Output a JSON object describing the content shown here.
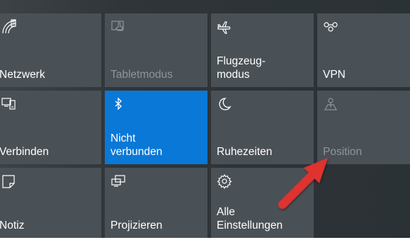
{
  "tiles": [
    {
      "id": "network",
      "label": "Netzwerk",
      "icon": "wifi-icon",
      "state": "normal"
    },
    {
      "id": "tablet",
      "label": "Tabletmodus",
      "icon": "tablet-mode-icon",
      "state": "disabled"
    },
    {
      "id": "airplane",
      "label": "Flugzeug-\nmodus",
      "icon": "airplane-icon",
      "state": "normal"
    },
    {
      "id": "vpn",
      "label": "VPN",
      "icon": "vpn-icon",
      "state": "normal"
    },
    {
      "id": "connect",
      "label": "Verbinden",
      "icon": "connect-icon",
      "state": "normal"
    },
    {
      "id": "bluetooth",
      "label": "Nicht\nverbunden",
      "icon": "bluetooth-icon",
      "state": "active"
    },
    {
      "id": "quiet",
      "label": "Ruhezeiten",
      "icon": "moon-icon",
      "state": "normal"
    },
    {
      "id": "location",
      "label": "Position",
      "icon": "location-icon",
      "state": "disabled"
    },
    {
      "id": "note",
      "label": "Notiz",
      "icon": "note-icon",
      "state": "normal"
    },
    {
      "id": "project",
      "label": "Projizieren",
      "icon": "project-icon",
      "state": "normal"
    },
    {
      "id": "settings",
      "label": "Alle\nEinstellungen",
      "icon": "gear-icon",
      "state": "normal"
    }
  ],
  "colors": {
    "tile": "#4a5156",
    "active": "#0a78d7",
    "arrow": "#e0312e"
  }
}
